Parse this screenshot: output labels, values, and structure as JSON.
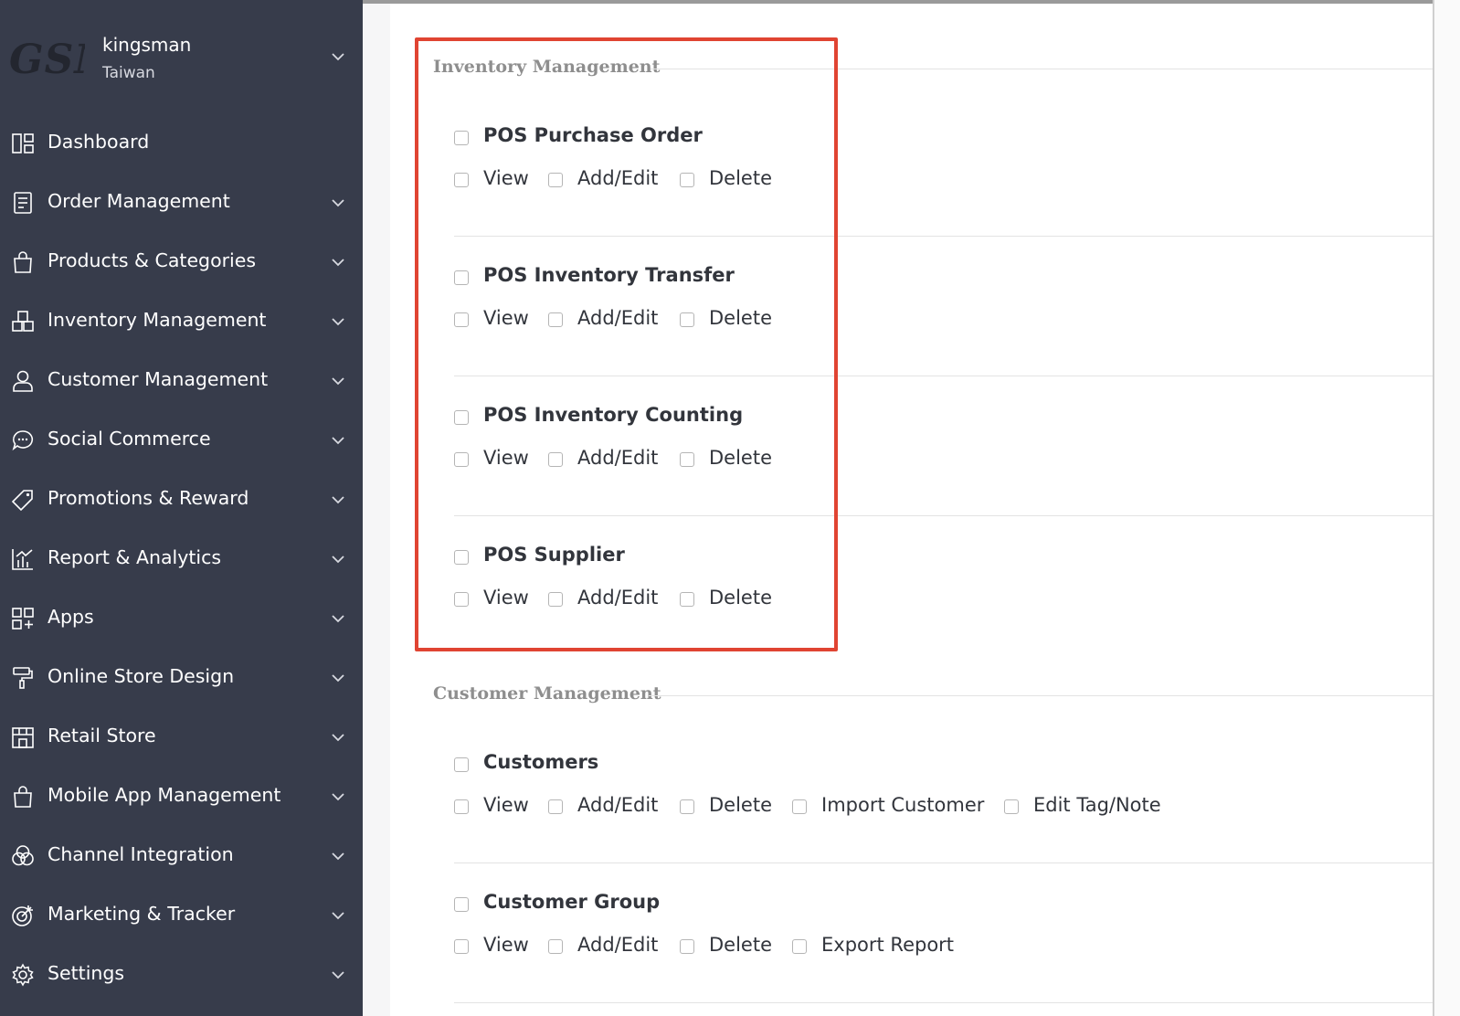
{
  "account": {
    "logo_text": "GSM",
    "name": "kingsman",
    "region": "Taiwan"
  },
  "nav": [
    {
      "label": "Dashboard",
      "icon": "dashboard-icon"
    },
    {
      "label": "Order Management",
      "icon": "clipboard-icon"
    },
    {
      "label": "Products & Categories",
      "icon": "shopping-bag-icon"
    },
    {
      "label": "Inventory Management",
      "icon": "boxes-icon"
    },
    {
      "label": "Customer Management",
      "icon": "user-icon"
    },
    {
      "label": "Social Commerce",
      "icon": "chat-icon"
    },
    {
      "label": "Promotions & Reward",
      "icon": "tag-icon"
    },
    {
      "label": "Report & Analytics",
      "icon": "bar-chart-icon"
    },
    {
      "label": "Apps",
      "icon": "apps-icon"
    },
    {
      "label": "Online Store Design",
      "icon": "paint-roller-icon"
    },
    {
      "label": "Retail Store",
      "icon": "store-icon"
    },
    {
      "label": "Mobile App Management",
      "icon": "shopping-bag-icon"
    },
    {
      "label": "Channel Integration",
      "icon": "circles-icon"
    },
    {
      "label": "Marketing & Tracker",
      "icon": "target-icon"
    },
    {
      "label": "Settings",
      "icon": "gear-icon"
    }
  ],
  "sections": {
    "inventory": {
      "title": "Inventory Management",
      "groups": [
        {
          "title": "POS Purchase Order",
          "options": [
            "View",
            "Add/Edit",
            "Delete"
          ]
        },
        {
          "title": "POS Inventory Transfer",
          "options": [
            "View",
            "Add/Edit",
            "Delete"
          ]
        },
        {
          "title": "POS Inventory Counting",
          "options": [
            "View",
            "Add/Edit",
            "Delete"
          ]
        },
        {
          "title": "POS Supplier",
          "options": [
            "View",
            "Add/Edit",
            "Delete"
          ]
        }
      ]
    },
    "customer": {
      "title": "Customer Management",
      "groups": [
        {
          "title": "Customers",
          "options": [
            "View",
            "Add/Edit",
            "Delete",
            "Import Customer",
            "Edit Tag/Note"
          ]
        },
        {
          "title": "Customer Group",
          "options": [
            "View",
            "Add/Edit",
            "Delete",
            "Export Report"
          ]
        }
      ]
    }
  },
  "colors": {
    "sidebar_bg": "#373c4b",
    "highlight_border": "#e04432"
  }
}
